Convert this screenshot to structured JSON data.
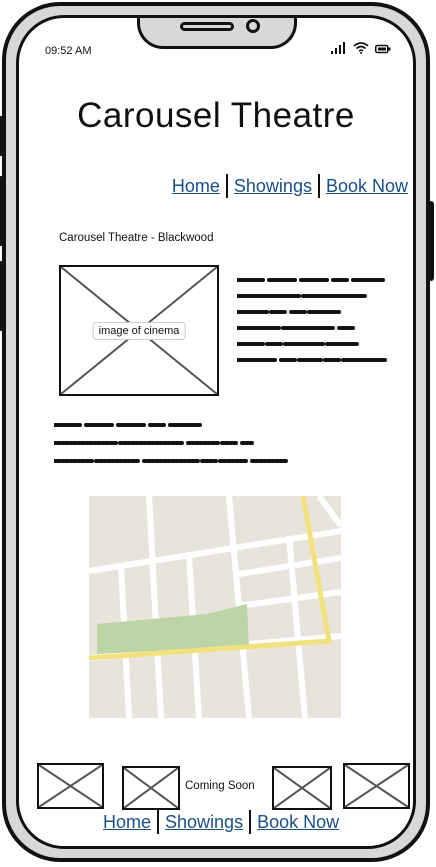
{
  "status_bar": {
    "time": "09:52 AM"
  },
  "header": {
    "title": "Carousel Theatre"
  },
  "nav": {
    "home": "Home",
    "showings": "Showings",
    "book_now": "Book Now"
  },
  "venue": {
    "name": "Carousel Theatre - Blackwood"
  },
  "main_image": {
    "label": "image of cinema"
  },
  "coming_soon": {
    "label": "Coming Soon"
  },
  "footer_nav": {
    "home": "Home",
    "showings": "Showings",
    "book_now": "Book Now"
  },
  "icons": [
    "signal-icon",
    "wifi-icon",
    "battery-icon",
    "placeholder-image-icon",
    "map-image"
  ]
}
